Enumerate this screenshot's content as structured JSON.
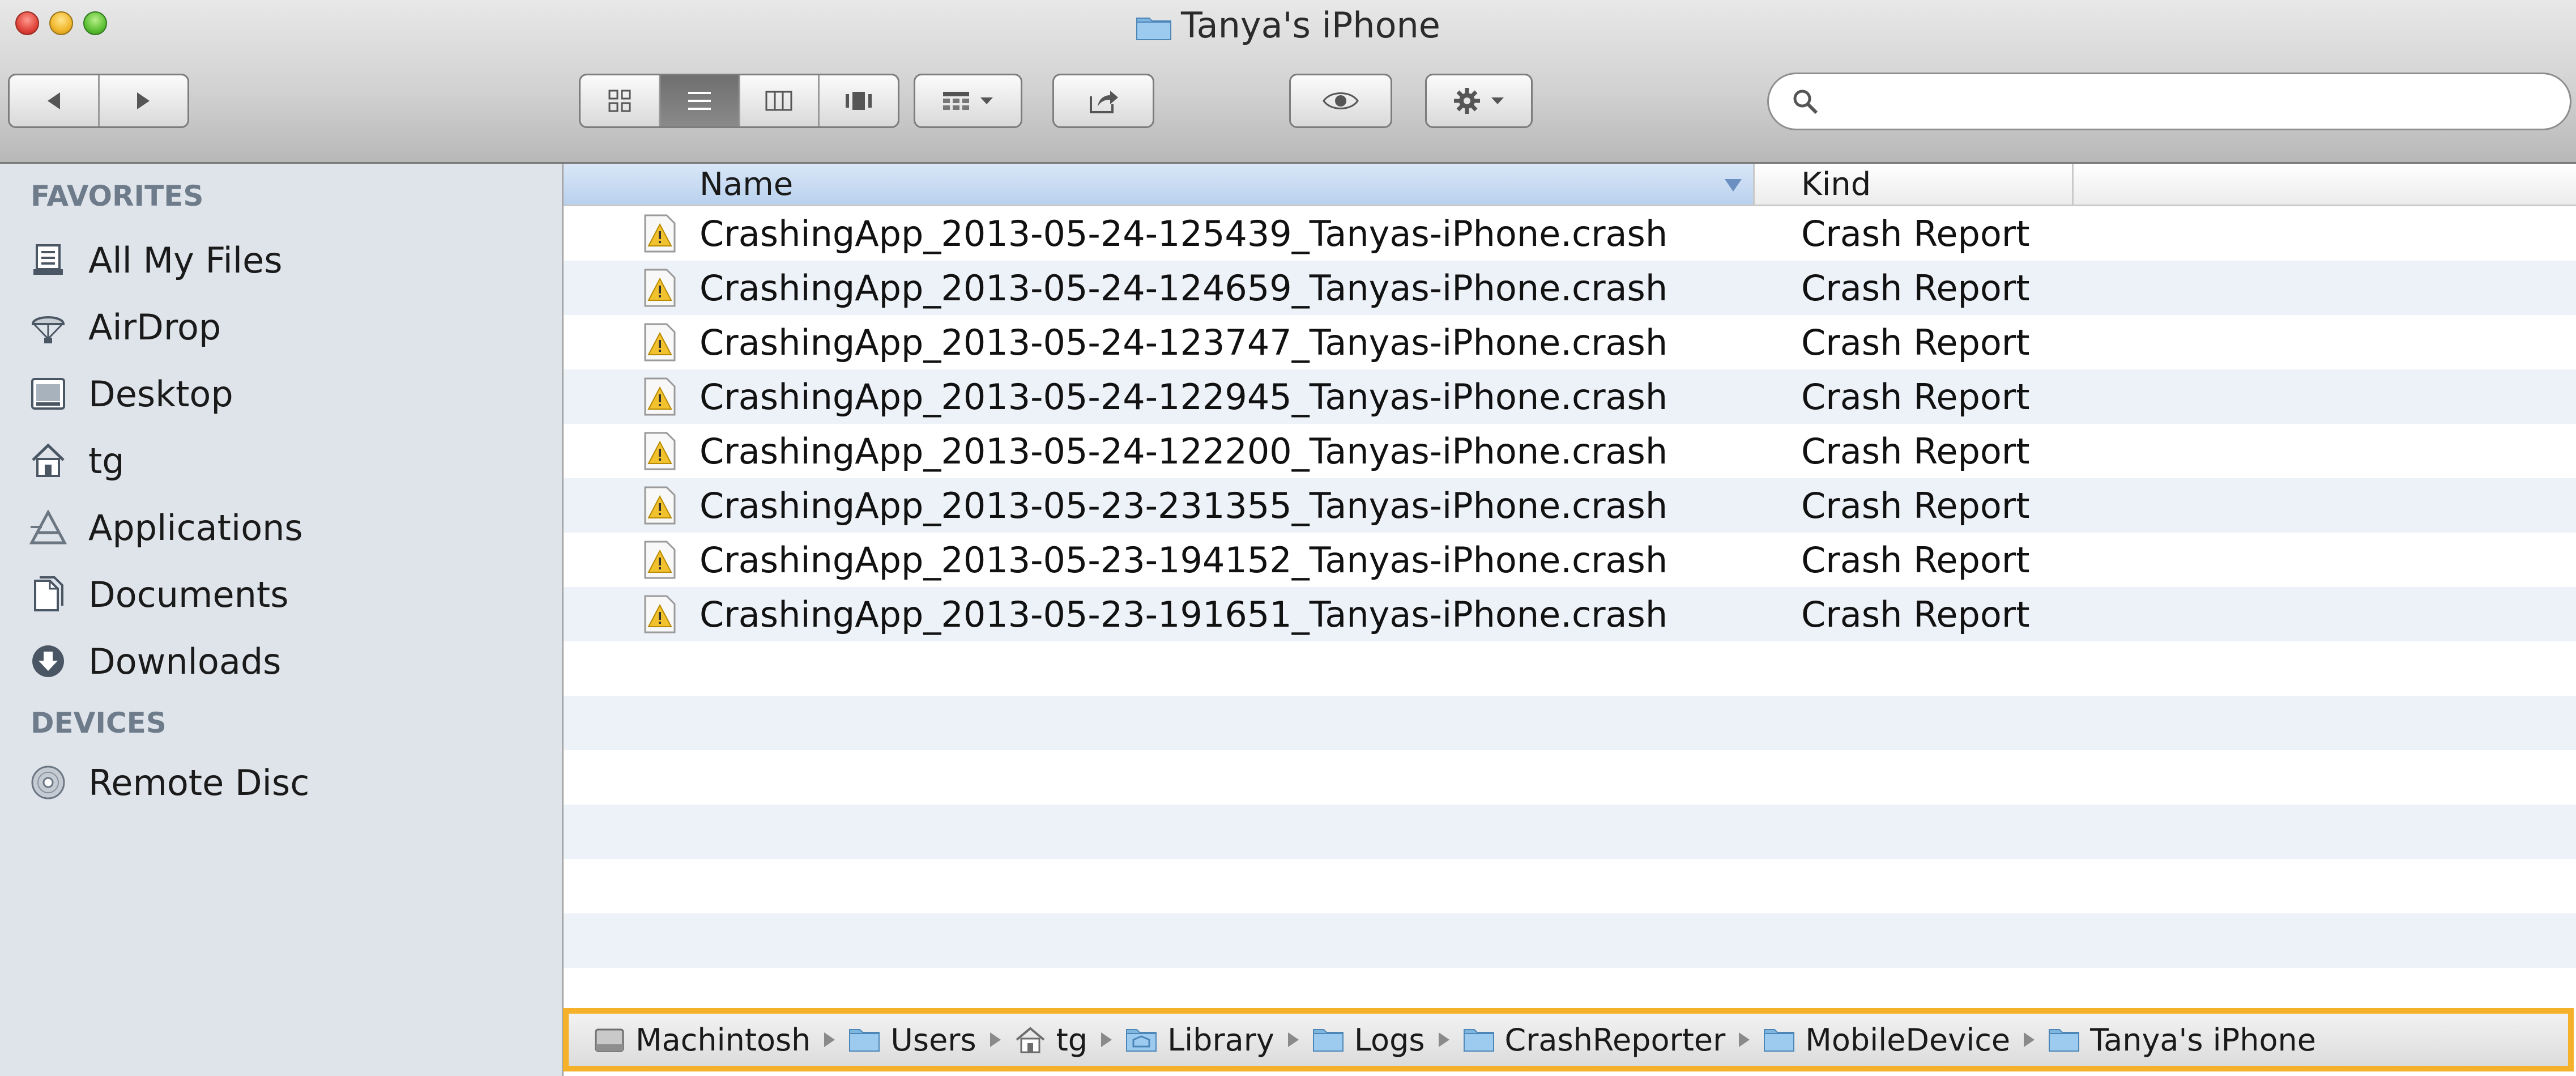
{
  "window": {
    "title": "Tanya's iPhone"
  },
  "search": {
    "placeholder": ""
  },
  "sidebar": {
    "favorites_heading": "FAVORITES",
    "favorites": [
      {
        "label": "All My Files",
        "icon": "all-my-files-icon"
      },
      {
        "label": "AirDrop",
        "icon": "airdrop-icon"
      },
      {
        "label": "Desktop",
        "icon": "desktop-icon"
      },
      {
        "label": "tg",
        "icon": "home-icon"
      },
      {
        "label": "Applications",
        "icon": "applications-icon"
      },
      {
        "label": "Documents",
        "icon": "documents-icon"
      },
      {
        "label": "Downloads",
        "icon": "downloads-icon"
      }
    ],
    "devices_heading": "DEVICES",
    "devices": [
      {
        "label": "Remote Disc",
        "icon": "disc-icon"
      }
    ]
  },
  "list": {
    "columns": {
      "name": "Name",
      "kind": "Kind"
    },
    "files": [
      {
        "name": "CrashingApp_2013-05-24-125439_Tanyas-iPhone.crash",
        "kind": "Crash Report"
      },
      {
        "name": "CrashingApp_2013-05-24-124659_Tanyas-iPhone.crash",
        "kind": "Crash Report"
      },
      {
        "name": "CrashingApp_2013-05-24-123747_Tanyas-iPhone.crash",
        "kind": "Crash Report"
      },
      {
        "name": "CrashingApp_2013-05-24-122945_Tanyas-iPhone.crash",
        "kind": "Crash Report"
      },
      {
        "name": "CrashingApp_2013-05-24-122200_Tanyas-iPhone.crash",
        "kind": "Crash Report"
      },
      {
        "name": "CrashingApp_2013-05-23-231355_Tanyas-iPhone.crash",
        "kind": "Crash Report"
      },
      {
        "name": "CrashingApp_2013-05-23-194152_Tanyas-iPhone.crash",
        "kind": "Crash Report"
      },
      {
        "name": "CrashingApp_2013-05-23-191651_Tanyas-iPhone.crash",
        "kind": "Crash Report"
      }
    ]
  },
  "pathbar": {
    "crumbs": [
      {
        "label": "Machintosh",
        "icon": "hard-drive-icon"
      },
      {
        "label": "Users",
        "icon": "folder-icon"
      },
      {
        "label": "tg",
        "icon": "home-icon"
      },
      {
        "label": "Library",
        "icon": "library-folder-icon"
      },
      {
        "label": "Logs",
        "icon": "folder-icon"
      },
      {
        "label": "CrashReporter",
        "icon": "folder-icon"
      },
      {
        "label": "MobileDevice",
        "icon": "folder-icon"
      },
      {
        "label": "Tanya's iPhone",
        "icon": "folder-icon"
      }
    ]
  },
  "colors": {
    "accent_highlight": "#f5b12a",
    "header_selected": "#c6dbf3",
    "sidebar_bg": "#dfe4ea",
    "row_alt": "#edf2f8"
  }
}
